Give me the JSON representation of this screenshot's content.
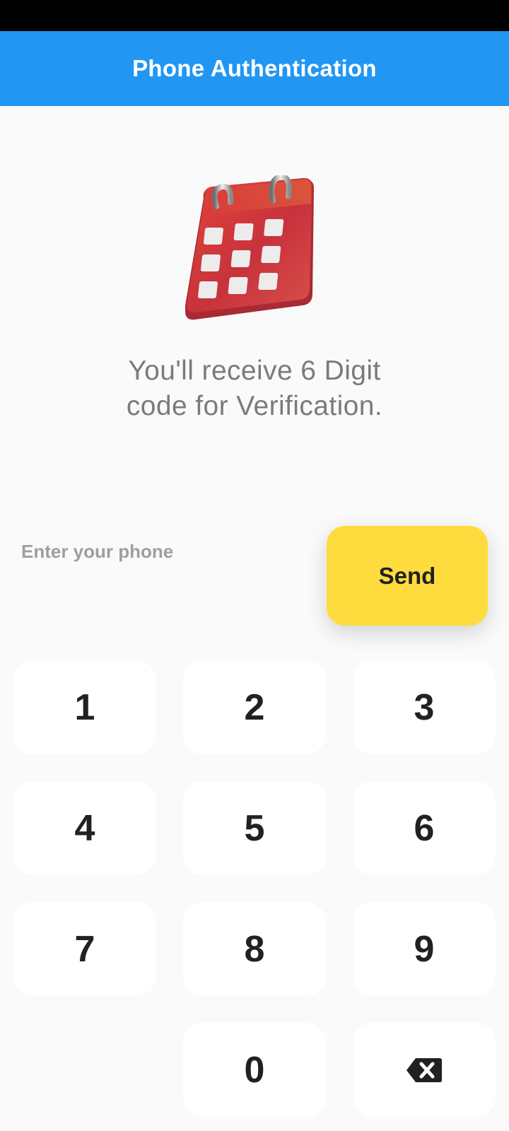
{
  "status_bar": {},
  "app_bar": {
    "title": "Phone Authentication"
  },
  "hero": {
    "icon": "calendar-icon"
  },
  "info": {
    "line1": "You'll receive 6 Digit",
    "line2": "code for Verification."
  },
  "phone_input": {
    "value": "",
    "placeholder": "Enter your phone"
  },
  "send_button": {
    "label": "Send"
  },
  "keypad": {
    "keys": [
      "1",
      "2",
      "3",
      "4",
      "5",
      "6",
      "7",
      "8",
      "9",
      "0"
    ],
    "backspace_icon": "backspace-icon"
  },
  "colors": {
    "app_bar": "#2196f3",
    "send_button": "#fedc3d",
    "background": "#fafafa",
    "key_background": "#ffffff"
  }
}
